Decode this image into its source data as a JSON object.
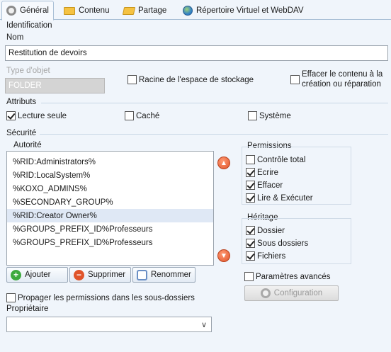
{
  "tabs": [
    {
      "label": "Général",
      "icon": "gear-icon"
    },
    {
      "label": "Contenu",
      "icon": "folder-icon"
    },
    {
      "label": "Partage",
      "icon": "share-folder-icon"
    },
    {
      "label": "Répertoire Virtuel et WebDAV",
      "icon": "globe-icon"
    }
  ],
  "identification": {
    "section_label": "Identification",
    "name_label": "Nom",
    "name_value": "Restitution de devoirs",
    "object_type_label": "Type d'objet",
    "object_type_value": "FOLDER",
    "storage_root_label": "Racine de l'espace de stockage",
    "storage_root_checked": false,
    "clear_content_label_line1": "Effacer le contenu à la",
    "clear_content_label_line2": "création ou réparation",
    "clear_content_checked": false
  },
  "attributes": {
    "section_label": "Attributs",
    "readonly_label": "Lecture seule",
    "readonly_checked": true,
    "hidden_label": "Caché",
    "hidden_checked": false,
    "system_label": "Système",
    "system_checked": false
  },
  "security": {
    "section_label": "Sécurité",
    "authority_label": "Autorité",
    "authorities": [
      "%RID:Administrators%",
      "%RID:LocalSystem%",
      "%KOXO_ADMINS%",
      "%SECONDARY_GROUP%",
      "%RID:Creator Owner%",
      "%GROUPS_PREFIX_ID%Professeurs",
      "%GROUPS_PREFIX_ID%Professeurs"
    ],
    "selected_index": 4,
    "permissions_label": "Permissions",
    "permissions": [
      {
        "label": "Contrôle total",
        "checked": false
      },
      {
        "label": "Ecrire",
        "checked": true
      },
      {
        "label": "Effacer",
        "checked": true
      },
      {
        "label": "Lire & Exécuter",
        "checked": true
      }
    ],
    "inheritance_label": "Héritage",
    "inheritance": [
      {
        "label": "Dossier",
        "checked": true
      },
      {
        "label": "Sous dossiers",
        "checked": true
      },
      {
        "label": "Fichiers",
        "checked": true
      }
    ],
    "add_label": "Ajouter",
    "delete_label": "Supprimer",
    "rename_label": "Renommer",
    "advanced_label": "Paramètres avancés",
    "advanced_checked": false,
    "config_label": "Configuration",
    "propagate_label": "Propager les permissions dans les sous-dossiers",
    "propagate_checked": false,
    "owner_label": "Propriétaire",
    "owner_value": ""
  }
}
